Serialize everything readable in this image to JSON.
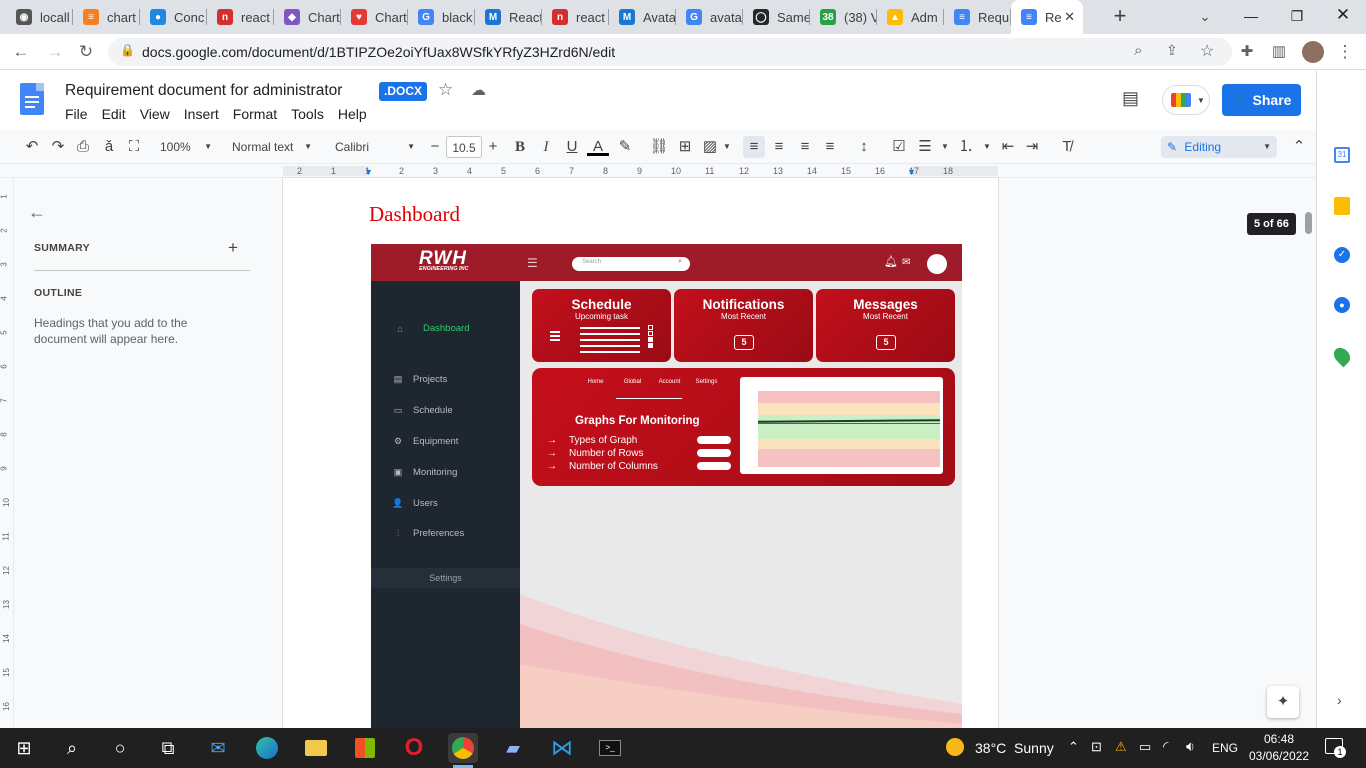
{
  "browser": {
    "tabs": [
      {
        "label": "locall",
        "color": "#555555",
        "glyph": "◉"
      },
      {
        "label": "chart",
        "color": "#f48024",
        "glyph": "≡"
      },
      {
        "label": "Conc",
        "color": "#1e88e5",
        "glyph": "●"
      },
      {
        "label": "react",
        "color": "#d32f2f",
        "glyph": "n"
      },
      {
        "label": "Chart",
        "color": "#7e57c2",
        "glyph": "◆"
      },
      {
        "label": "Chart",
        "color": "#e53935",
        "glyph": "♥"
      },
      {
        "label": "black",
        "color": "#4285f4",
        "glyph": "G"
      },
      {
        "label": "React",
        "color": "#1976d2",
        "glyph": "M"
      },
      {
        "label": "react",
        "color": "#d32f2f",
        "glyph": "n"
      },
      {
        "label": "Avata",
        "color": "#1976d2",
        "glyph": "M"
      },
      {
        "label": "avata",
        "color": "#4285f4",
        "glyph": "G"
      },
      {
        "label": "Same",
        "color": "#24292e",
        "glyph": "◯"
      },
      {
        "label": "(38) V",
        "color": "#25a244",
        "glyph": "38"
      },
      {
        "label": "Adm",
        "color": "#fbbc04",
        "glyph": "▲"
      },
      {
        "label": "Requ",
        "color": "#4285f4",
        "glyph": "≡"
      },
      {
        "label": "Re",
        "color": "#4285f4",
        "glyph": "≡"
      }
    ],
    "url": "docs.google.com/document/d/1BTIPZOe2oiYfUax8WSfkYRfyZ3HZrd6N/edit"
  },
  "doc": {
    "title": "Requirement document for administrator",
    "badge": ".DOCX",
    "menu": [
      "File",
      "Edit",
      "View",
      "Insert",
      "Format",
      "Tools",
      "Help"
    ],
    "share_label": "Share"
  },
  "toolbar": {
    "zoom": "100%",
    "style": "Normal text",
    "font": "Calibri",
    "font_size": "10.5",
    "mode": "Editing"
  },
  "ruler": {
    "marks": [
      "2",
      "1",
      "1",
      "2",
      "3",
      "4",
      "5",
      "6",
      "7",
      "8",
      "9",
      "10",
      "11",
      "12",
      "13",
      "14",
      "15",
      "16",
      "17",
      "18"
    ],
    "vmarks": [
      "1",
      "2",
      "3",
      "4",
      "5",
      "6",
      "7",
      "8",
      "9",
      "10",
      "11",
      "12",
      "13",
      "14",
      "15",
      "16"
    ]
  },
  "outline_panel": {
    "summary": "SUMMARY",
    "outline": "OUTLINE",
    "hint": "Headings that you add to the document will appear here."
  },
  "page_indicator": "5 of 66",
  "page": {
    "heading": "Dashboard"
  },
  "mockup": {
    "logo": "RWH",
    "logo_sub": "ENGINEERING INC",
    "search_placeholder": "Search",
    "nav": [
      {
        "label": "Dashboard",
        "active": true,
        "icon": "home-icon",
        "glyph": "⌂"
      },
      {
        "label": "Projects",
        "active": false,
        "icon": "projects-icon",
        "glyph": "▤"
      },
      {
        "label": "Schedule",
        "active": false,
        "icon": "calendar-icon",
        "glyph": "▭"
      },
      {
        "label": "Equipment",
        "active": false,
        "icon": "equipment-icon",
        "glyph": "⚙"
      },
      {
        "label": "Monitoring",
        "active": false,
        "icon": "monitor-icon",
        "glyph": "▣"
      },
      {
        "label": "Users",
        "active": false,
        "icon": "users-icon",
        "glyph": "👤"
      },
      {
        "label": "Preferences",
        "active": false,
        "icon": "sliders-icon",
        "glyph": "⫶"
      }
    ],
    "settings_label": "Settings",
    "cards": [
      {
        "title": "Schedule",
        "subtitle": "Upcoming task"
      },
      {
        "title": "Notifications",
        "subtitle": "Most Recent",
        "count": "5"
      },
      {
        "title": "Messages",
        "subtitle": "Most Recent",
        "count": "5"
      }
    ],
    "graph_panel": {
      "tabs": [
        "Home",
        "Global",
        "Account",
        "Settings"
      ],
      "title": "Graphs For Monitoring",
      "rows": [
        "Types of Graph",
        "Number of Rows",
        "Number of Columns"
      ]
    }
  },
  "taskbar": {
    "weather": "38°C  Sunny",
    "lang": "ENG",
    "time": "06:48",
    "date": "03/06/2022",
    "notif_count": "1"
  }
}
